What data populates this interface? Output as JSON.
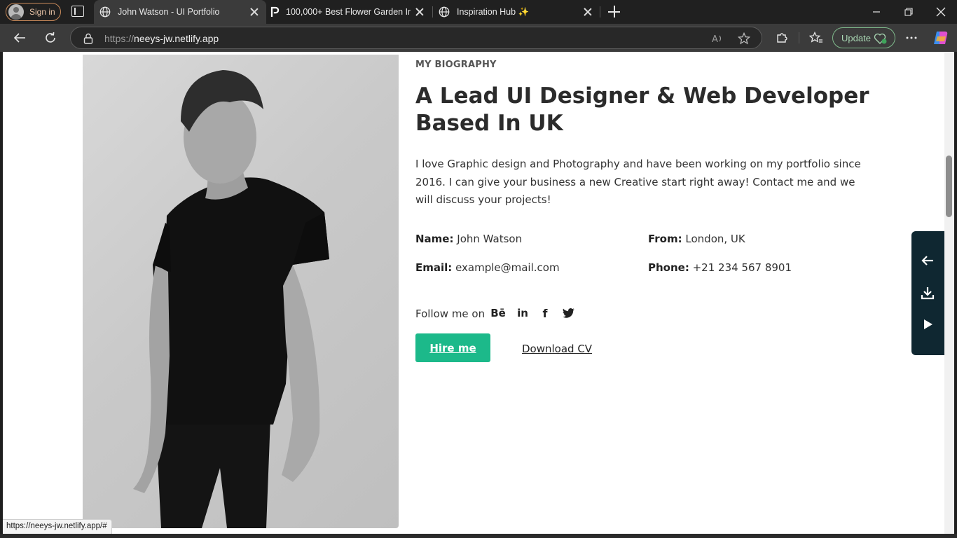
{
  "browser": {
    "signin_label": "Sign in",
    "tabs": [
      {
        "title": "John Watson - UI Portfolio",
        "icon": "globe-icon",
        "active": true
      },
      {
        "title": "100,000+ Best Flower Garden Ima",
        "icon": "pexels-icon",
        "active": false
      },
      {
        "title": "Inspiration Hub ✨",
        "icon": "globe-icon",
        "active": false
      }
    ],
    "url_scheme": "https://",
    "url_host": "neeys-jw.netlify.app",
    "update_label": "Update",
    "status_url": "https://neeys-jw.netlify.app/#"
  },
  "page": {
    "subtitle": "MY BIOGRAPHY",
    "headline": "A Lead UI Designer & Web Developer Based In UK",
    "intro": "I love Graphic design and Photography and have been working on my portfolio since 2016. I can give your business a new Creative start right away! Contact me and we will discuss your projects!",
    "info": {
      "name_label": "Name:",
      "name_value": "John Watson",
      "from_label": "From:",
      "from_value": "London, UK",
      "email_label": "Email:",
      "email_value": "example@mail.com",
      "phone_label": "Phone:",
      "phone_value": "+21 234 567 8901"
    },
    "follow_label": "Follow me on",
    "social": [
      {
        "name": "behance-icon",
        "glyph": "Bē"
      },
      {
        "name": "linkedin-icon",
        "glyph": "in"
      },
      {
        "name": "facebook-icon",
        "glyph": "f"
      },
      {
        "name": "twitter-icon",
        "glyph": ""
      }
    ],
    "hire_label": "Hire me",
    "download_label": "Download CV",
    "side_panel": [
      "back-arrow-icon",
      "download-icon",
      "play-icon"
    ]
  },
  "colors": {
    "accent_green": "#1cb98a",
    "side_panel_bg": "#0f2731",
    "chrome_dark": "#202020",
    "toolbar": "#3b3b3b"
  }
}
